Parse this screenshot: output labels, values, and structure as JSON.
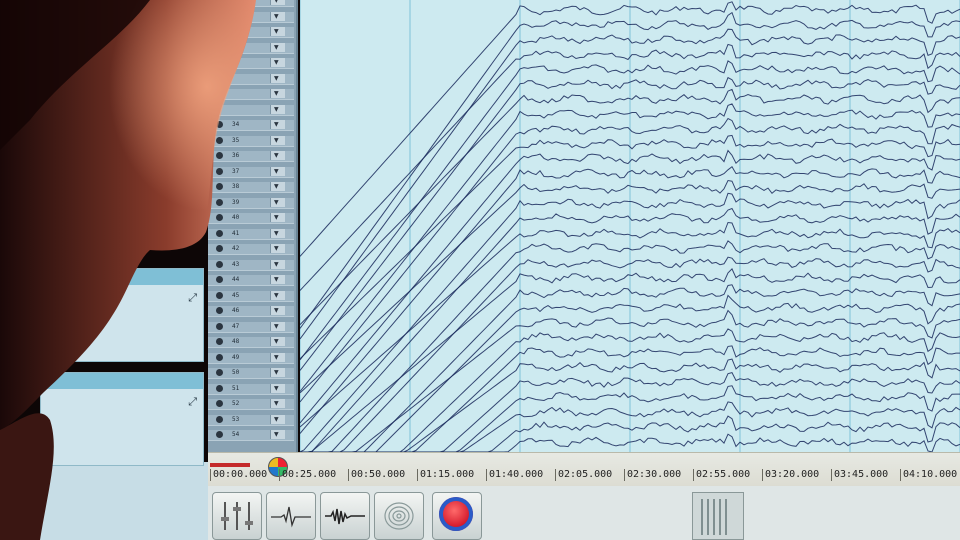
{
  "timeline": {
    "ticks": [
      "00:00.000",
      "00:25.000",
      "00:50.000",
      "01:15.000",
      "01:40.000",
      "02:05.000",
      "02:30.000",
      "02:55.000",
      "03:20.000",
      "03:45.000",
      "04:10.000"
    ]
  },
  "channels": {
    "numbers": [
      "34",
      "35",
      "36",
      "37",
      "38",
      "39",
      "40",
      "41",
      "42",
      "43",
      "44",
      "45",
      "46",
      "47",
      "48",
      "49",
      "50",
      "51",
      "52",
      "53",
      "54"
    ]
  },
  "toolbar": {
    "buttons": [
      "sliders-icon",
      "ecg-wave-icon",
      "audio-wave-icon",
      "fingerprint-icon",
      "record-icon",
      "level-meter-icon"
    ]
  },
  "colors": {
    "trace_background": "#cdeaf0",
    "trace_line": "#18285a",
    "grid_line": "#4aa8c7",
    "record_red": "#d3182a",
    "skin_highlight": "#e2886c"
  }
}
